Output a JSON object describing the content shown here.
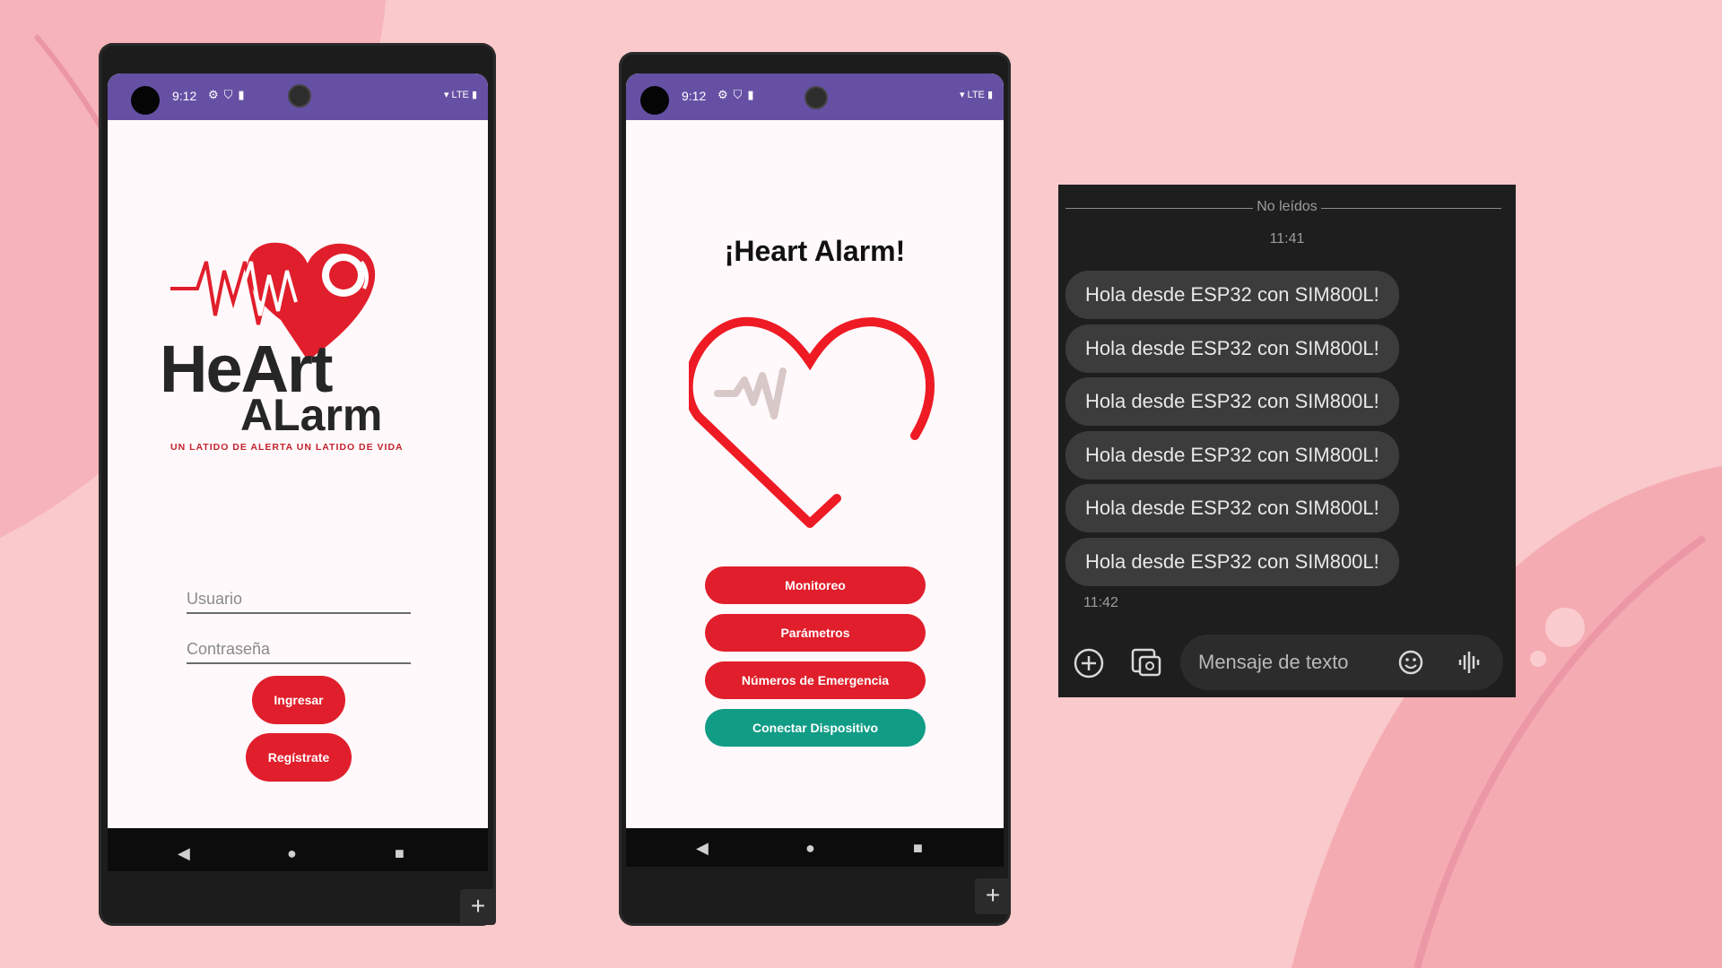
{
  "phone1": {
    "status": {
      "time": "9:12",
      "network": "LTE"
    },
    "logo": {
      "word1": "HeArt",
      "word2": "ALarm",
      "tagline": "UN LATIDO DE ALERTA UN LATIDO DE VIDA"
    },
    "username_placeholder": "Usuario",
    "password_placeholder": "Contraseña",
    "login_label": "Ingresar",
    "register_label": "Regístrate"
  },
  "phone2": {
    "status": {
      "time": "9:12",
      "network": "LTE"
    },
    "title": "¡Heart Alarm!",
    "buttons": [
      {
        "label": "Monitoreo"
      },
      {
        "label": "Parámetros"
      },
      {
        "label": "Números de Emergencia"
      },
      {
        "label": "Conectar Dispositivo"
      }
    ]
  },
  "chat": {
    "unread_label": "No leídos",
    "time1": "11:41",
    "messages": [
      "Hola desde ESP32 con SIM800L!",
      "Hola desde ESP32 con SIM800L!",
      "Hola desde ESP32 con SIM800L!",
      "Hola desde ESP32 con SIM800L!",
      "Hola desde ESP32 con SIM800L!",
      "Hola desde ESP32 con SIM800L!"
    ],
    "time2": "11:42",
    "input_placeholder": "Mensaje de texto"
  },
  "colors": {
    "background": "#f9c9cb",
    "accent_red": "#e11e2b",
    "teal": "#119c86",
    "status_purple": "#6650a4"
  }
}
